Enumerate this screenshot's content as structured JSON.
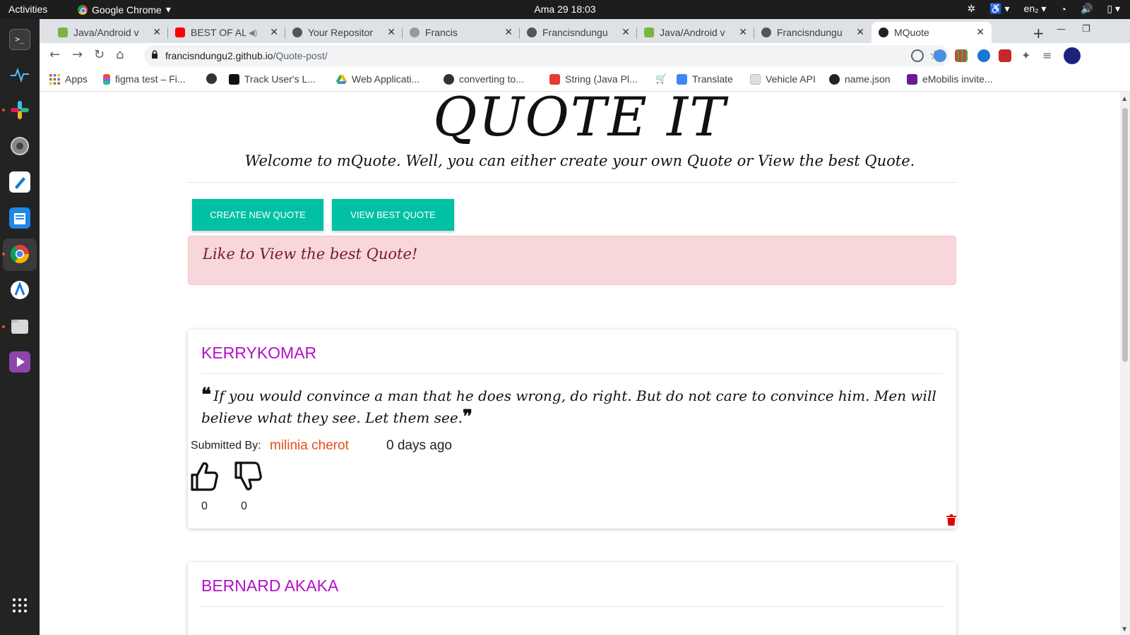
{
  "system": {
    "activities": "Activities",
    "app_name": "Google Chrome",
    "clock": "Ama 29  18:03",
    "lang": "en₂"
  },
  "tabs": [
    {
      "label": "Java/Android v",
      "fav_color": "#7cb342"
    },
    {
      "label": "BEST OF AL",
      "fav_color": "#ff0000"
    },
    {
      "label": "Your Repositor",
      "fav_color": "#555555"
    },
    {
      "label": "Francis",
      "fav_color": "#888888"
    },
    {
      "label": "Francisndungu",
      "fav_color": "#555555"
    },
    {
      "label": "Java/Android v",
      "fav_color": "#7cb342"
    },
    {
      "label": "Francisndungu",
      "fav_color": "#555555"
    },
    {
      "label": "MQuote",
      "fav_color": "#222222"
    }
  ],
  "address": {
    "host": "francisndungu2.github.io",
    "path": "/Quote-post/"
  },
  "bookmarks": [
    {
      "label": "Apps"
    },
    {
      "label": "figma test – Fi..."
    },
    {
      "label": ""
    },
    {
      "label": "Track User's L..."
    },
    {
      "label": "Web Applicati..."
    },
    {
      "label": "converting to..."
    },
    {
      "label": "String (Java Pl..."
    },
    {
      "label": ""
    },
    {
      "label": "Translate"
    },
    {
      "label": "Vehicle API"
    },
    {
      "label": "name.json"
    },
    {
      "label": "eMobilis invite..."
    }
  ],
  "page": {
    "brand": "QUOTE IT",
    "welcome": "Welcome to mQuote. Well, you can either create your own Quote or View the best Quote.",
    "create_button": "CREATE NEW QUOTE",
    "view_button": "VIEW BEST QUOTE",
    "alert": "Like to View the best Quote!",
    "submitted_label": "Submitted By:"
  },
  "quotes": [
    {
      "author": "KERRYKOMAR",
      "text": "If you would convince a man that he does wrong, do right. But do not care to convince him. Men will believe what they see. Let them see.",
      "submitted_by": "milinia cherot",
      "time_ago": "0 days ago",
      "likes": "0",
      "dislikes": "0"
    },
    {
      "author": "BERNARD AKAKA"
    }
  ],
  "colors": {
    "accent_button": "#00c1a4",
    "author": "#b40fc8",
    "submitter": "#e84c1a",
    "alert_bg": "#f8d7da",
    "delete": "#e00000"
  }
}
